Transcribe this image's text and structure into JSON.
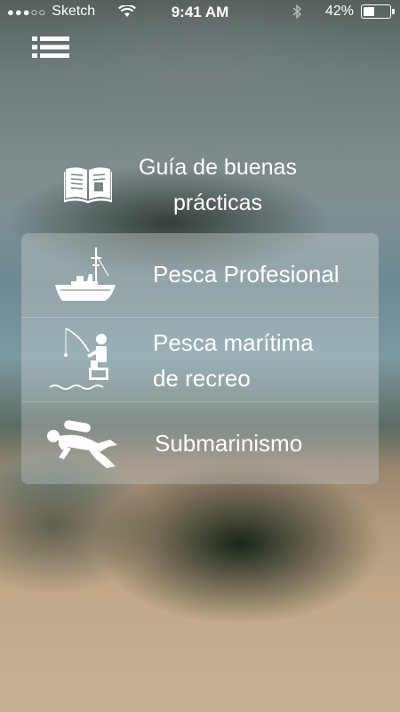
{
  "status_bar": {
    "signal": "●●●○○",
    "carrier": "Sketch",
    "time": "9:41 AM",
    "battery_percent": "42%",
    "battery_level": 0.42
  },
  "header": {
    "menu_icon": "hamburger-menu-icon",
    "title_icon": "book-icon",
    "title_line1": "Guía de buenas",
    "title_line2": "prácticas"
  },
  "menu": {
    "items": [
      {
        "icon": "fishing-boat-icon",
        "label_line1": "Pesca Profesional",
        "label_line2": ""
      },
      {
        "icon": "recreational-fisher-icon",
        "label_line1": "Pesca marítima",
        "label_line2": "de recreo"
      },
      {
        "icon": "scuba-diver-icon",
        "label_line1": "Submarinismo",
        "label_line2": ""
      }
    ]
  },
  "colors": {
    "text": "#ffffff",
    "card": "rgba(200,205,205,0.42)"
  }
}
